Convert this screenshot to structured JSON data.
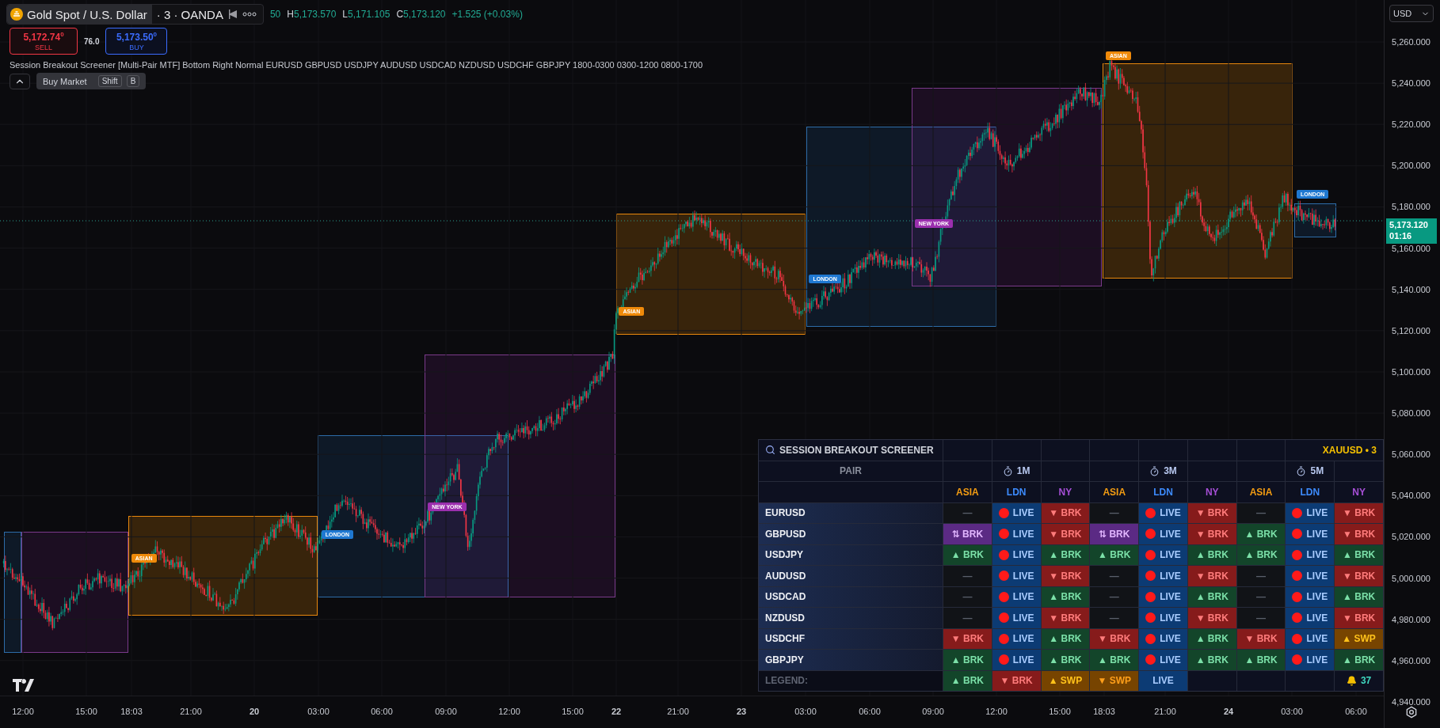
{
  "symbol": {
    "name": "Gold Spot / U.S. Dollar",
    "meta": "· 3 · OANDA"
  },
  "ohlc": [
    {
      "value": "50"
    },
    {
      "label": "H",
      "value": "5,173.570"
    },
    {
      "label": "L",
      "value": "5,171.105"
    },
    {
      "label": "C",
      "value": "5,173.120"
    }
  ],
  "change": "+1.525 (+0.03%)",
  "trade": {
    "sell_price": "5,172.74$^{0}$",
    "sell_label": "SELL",
    "spread": "76.0",
    "buy_price": "5,173.50$^{0}$",
    "buy_label": "BUY"
  },
  "indicator": "Session Breakout Screener [Multi-Pair MTF] Bottom Right Normal EURUSD GBPUSD USDJPY AUDUSD USDCAD NZDUSD USDCHF GBPJPY 1800-0300 0300-1200 0800-1700",
  "tooltip": {
    "text": "Buy Market",
    "keys": [
      "Shift",
      "B"
    ]
  },
  "sessions": [
    {
      "kind": "london"
    },
    {
      "kind": "new_york"
    },
    {
      "kind": "asian",
      "label": "ASIAN"
    },
    {
      "kind": "london",
      "label": "LONDON"
    },
    {
      "kind": "new_york",
      "label": "NEW YORK"
    },
    {
      "kind": "asian",
      "label": "ASIAN"
    },
    {
      "kind": "london",
      "label": "LONDON"
    },
    {
      "kind": "new_york",
      "label": "NEW YORK"
    },
    {
      "kind": "asian",
      "label": "ASIAN"
    },
    {
      "kind": "london",
      "label": "LONDON"
    }
  ],
  "price_axis": {
    "currency": "USD",
    "ticks": [
      "5,260.000",
      "5,240.000",
      "5,220.000",
      "5,200.000",
      "5,180.000",
      "5,160.000",
      "5,140.000",
      "5,120.000",
      "5,100.000",
      "5,080.000",
      "5,060.000",
      "5,040.000",
      "5,020.000",
      "5,000.000",
      "4,980.000",
      "4,960.000",
      "4,940.000"
    ],
    "last_price": "5,173.120",
    "countdown": "01:16"
  },
  "time_axis": [
    {
      "label": "12:00"
    },
    {
      "label": "15:00"
    },
    {
      "label": "18:03"
    },
    {
      "label": "21:00"
    },
    {
      "label": "20",
      "kind": "day"
    },
    {
      "label": "03:00"
    },
    {
      "label": "06:00"
    },
    {
      "label": "09:00"
    },
    {
      "label": "12:00"
    },
    {
      "label": "15:00"
    },
    {
      "label": "22",
      "kind": "day"
    },
    {
      "label": "21:00"
    },
    {
      "label": "23",
      "kind": "day"
    },
    {
      "label": "03:00"
    },
    {
      "label": "06:00"
    },
    {
      "label": "09:00"
    },
    {
      "label": "12:00"
    },
    {
      "label": "15:00"
    },
    {
      "label": "18:03"
    },
    {
      "label": "21:00"
    },
    {
      "label": "24",
      "kind": "day"
    },
    {
      "label": "03:00"
    },
    {
      "label": "06:00"
    }
  ],
  "screener": {
    "title": "SESSION BREAKOUT SCREENER",
    "badge": "XAUUSD • 3",
    "pair_header": "PAIR",
    "timeframes": [
      "1M",
      "3M",
      "5M"
    ],
    "sessions": [
      {
        "label": "ASIA",
        "color": "#f39c12"
      },
      {
        "label": "LDN",
        "color": "#3d8bfd"
      },
      {
        "label": "NY",
        "color": "#a64fd6"
      },
      {
        "label": "ASIA",
        "color": "#f39c12"
      },
      {
        "label": "LDN",
        "color": "#3d8bfd"
      },
      {
        "label": "NY",
        "color": "#a64fd6"
      },
      {
        "label": "ASIA",
        "color": "#f39c12"
      },
      {
        "label": "LDN",
        "color": "#3d8bfd"
      },
      {
        "label": "NY",
        "color": "#a64fd6"
      }
    ],
    "rows": [
      {
        "pair": "EURUSD",
        "cells": [
          {
            "kind": "none",
            "text": "—"
          },
          {
            "kind": "live",
            "text": "LIVE"
          },
          {
            "kind": "down",
            "text": "▼ BRK"
          },
          {
            "kind": "none",
            "text": "—"
          },
          {
            "kind": "live",
            "text": "LIVE"
          },
          {
            "kind": "down",
            "text": "▼ BRK"
          },
          {
            "kind": "none",
            "text": "—"
          },
          {
            "kind": "live",
            "text": "LIVE"
          },
          {
            "kind": "down",
            "text": "▼ BRK"
          }
        ]
      },
      {
        "pair": "GBPUSD",
        "cells": [
          {
            "kind": "both",
            "text": "⇅ BRK"
          },
          {
            "kind": "live",
            "text": "LIVE"
          },
          {
            "kind": "down",
            "text": "▼ BRK"
          },
          {
            "kind": "both",
            "text": "⇅ BRK"
          },
          {
            "kind": "live",
            "text": "LIVE"
          },
          {
            "kind": "down",
            "text": "▼ BRK"
          },
          {
            "kind": "up",
            "text": "▲ BRK"
          },
          {
            "kind": "live",
            "text": "LIVE"
          },
          {
            "kind": "down",
            "text": "▼ BRK"
          }
        ]
      },
      {
        "pair": "USDJPY",
        "cells": [
          {
            "kind": "up",
            "text": "▲ BRK"
          },
          {
            "kind": "live",
            "text": "LIVE"
          },
          {
            "kind": "up",
            "text": "▲ BRK"
          },
          {
            "kind": "up",
            "text": "▲ BRK"
          },
          {
            "kind": "live",
            "text": "LIVE"
          },
          {
            "kind": "up",
            "text": "▲ BRK"
          },
          {
            "kind": "up",
            "text": "▲ BRK"
          },
          {
            "kind": "live",
            "text": "LIVE"
          },
          {
            "kind": "up",
            "text": "▲ BRK"
          }
        ]
      },
      {
        "pair": "AUDUSD",
        "cells": [
          {
            "kind": "none",
            "text": "—"
          },
          {
            "kind": "live",
            "text": "LIVE"
          },
          {
            "kind": "down",
            "text": "▼ BRK"
          },
          {
            "kind": "none",
            "text": "—"
          },
          {
            "kind": "live",
            "text": "LIVE"
          },
          {
            "kind": "down",
            "text": "▼ BRK"
          },
          {
            "kind": "none",
            "text": "—"
          },
          {
            "kind": "live",
            "text": "LIVE"
          },
          {
            "kind": "down",
            "text": "▼ BRK"
          }
        ]
      },
      {
        "pair": "USDCAD",
        "cells": [
          {
            "kind": "none",
            "text": "—"
          },
          {
            "kind": "live",
            "text": "LIVE"
          },
          {
            "kind": "up",
            "text": "▲ BRK"
          },
          {
            "kind": "none",
            "text": "—"
          },
          {
            "kind": "live",
            "text": "LIVE"
          },
          {
            "kind": "up",
            "text": "▲ BRK"
          },
          {
            "kind": "none",
            "text": "—"
          },
          {
            "kind": "live",
            "text": "LIVE"
          },
          {
            "kind": "up",
            "text": "▲ BRK"
          }
        ]
      },
      {
        "pair": "NZDUSD",
        "cells": [
          {
            "kind": "none",
            "text": "—"
          },
          {
            "kind": "live",
            "text": "LIVE"
          },
          {
            "kind": "down",
            "text": "▼ BRK"
          },
          {
            "kind": "none",
            "text": "—"
          },
          {
            "kind": "live",
            "text": "LIVE"
          },
          {
            "kind": "down",
            "text": "▼ BRK"
          },
          {
            "kind": "none",
            "text": "—"
          },
          {
            "kind": "live",
            "text": "LIVE"
          },
          {
            "kind": "down",
            "text": "▼ BRK"
          }
        ]
      },
      {
        "pair": "USDCHF",
        "cells": [
          {
            "kind": "down",
            "text": "▼ BRK"
          },
          {
            "kind": "live",
            "text": "LIVE"
          },
          {
            "kind": "up",
            "text": "▲ BRK"
          },
          {
            "kind": "down",
            "text": "▼ BRK"
          },
          {
            "kind": "live",
            "text": "LIVE"
          },
          {
            "kind": "up",
            "text": "▲ BRK"
          },
          {
            "kind": "down",
            "text": "▼ BRK"
          },
          {
            "kind": "live",
            "text": "LIVE"
          },
          {
            "kind": "swp_up",
            "text": "▲ SWP"
          }
        ]
      },
      {
        "pair": "GBPJPY",
        "cells": [
          {
            "kind": "up",
            "text": "▲ BRK"
          },
          {
            "kind": "live",
            "text": "LIVE"
          },
          {
            "kind": "up",
            "text": "▲ BRK"
          },
          {
            "kind": "up",
            "text": "▲ BRK"
          },
          {
            "kind": "live",
            "text": "LIVE"
          },
          {
            "kind": "up",
            "text": "▲ BRK"
          },
          {
            "kind": "up",
            "text": "▲ BRK"
          },
          {
            "kind": "live",
            "text": "LIVE"
          },
          {
            "kind": "up",
            "text": "▲ BRK"
          }
        ]
      }
    ],
    "legend_label": "LEGEND:",
    "legend": [
      {
        "kind": "up",
        "text": "▲ BRK"
      },
      {
        "kind": "down",
        "text": "▼ BRK"
      },
      {
        "kind": "swp_up",
        "text": "▲ SWP"
      },
      {
        "kind": "swp_down",
        "text": "▼ SWP"
      },
      {
        "kind": "live_key",
        "text": "LIVE"
      }
    ],
    "alert_count": "37"
  }
}
